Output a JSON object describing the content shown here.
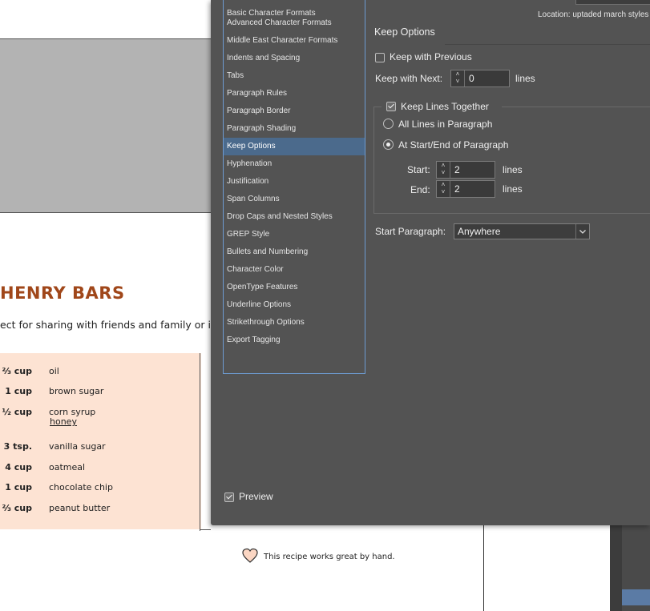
{
  "document": {
    "title": "HENRY BARS",
    "subtitle": "ect for sharing with friends and family or in",
    "ingredients": [
      {
        "qty": "⅔ cup",
        "name": "oil"
      },
      {
        "qty": "1 cup",
        "name": "brown sugar"
      },
      {
        "qty": "½ cup",
        "name": "corn syrup"
      },
      {
        "qty": "3 tsp.",
        "name": "vanilla sugar"
      },
      {
        "qty": "4 cup",
        "name": "oatmeal"
      },
      {
        "qty": "1 cup",
        "name": "chocolate chip"
      },
      {
        "qty": "⅔ cup",
        "name": "peanut butter"
      }
    ],
    "honey_link": "honey",
    "note": "This recipe works great by hand.",
    "colors": {
      "title": "#a0471a",
      "ingredients_bg": "#fde3d3",
      "frame_gray": "#b3b3b3"
    }
  },
  "dialog": {
    "location_label": "Location:",
    "location_value": "uptaded march styles",
    "categories": [
      "Basic Character Formats",
      "Advanced Character Formats",
      "Middle East Character Formats",
      "Indents and Spacing",
      "Tabs",
      "Paragraph Rules",
      "Paragraph Border",
      "Paragraph Shading",
      "Keep Options",
      "Hyphenation",
      "Justification",
      "Span Columns",
      "Drop Caps and Nested Styles",
      "GREP Style",
      "Bullets and Numbering",
      "Character Color",
      "OpenType Features",
      "Underline Options",
      "Strikethrough Options",
      "Export Tagging"
    ],
    "selected_category": "Keep Options",
    "section_title": "Keep Options",
    "keep_with_previous": {
      "label": "Keep with Previous",
      "checked": false
    },
    "keep_with_next": {
      "label": "Keep with Next:",
      "value": "0",
      "unit": "lines"
    },
    "keep_lines_together": {
      "label": "Keep Lines Together",
      "checked": true
    },
    "all_lines": {
      "label": "All Lines in Paragraph",
      "selected": false
    },
    "at_start_end": {
      "label": "At Start/End of Paragraph",
      "selected": true
    },
    "start": {
      "label": "Start:",
      "value": "2",
      "unit": "lines"
    },
    "end": {
      "label": "End:",
      "value": "2",
      "unit": "lines"
    },
    "start_paragraph": {
      "label": "Start Paragraph:",
      "value": "Anywhere"
    },
    "preview": {
      "label": "Preview",
      "checked": true
    },
    "colors": {
      "bg": "#535353",
      "selection": "#4b6a8c",
      "list_border": "#6d9bd1"
    }
  }
}
